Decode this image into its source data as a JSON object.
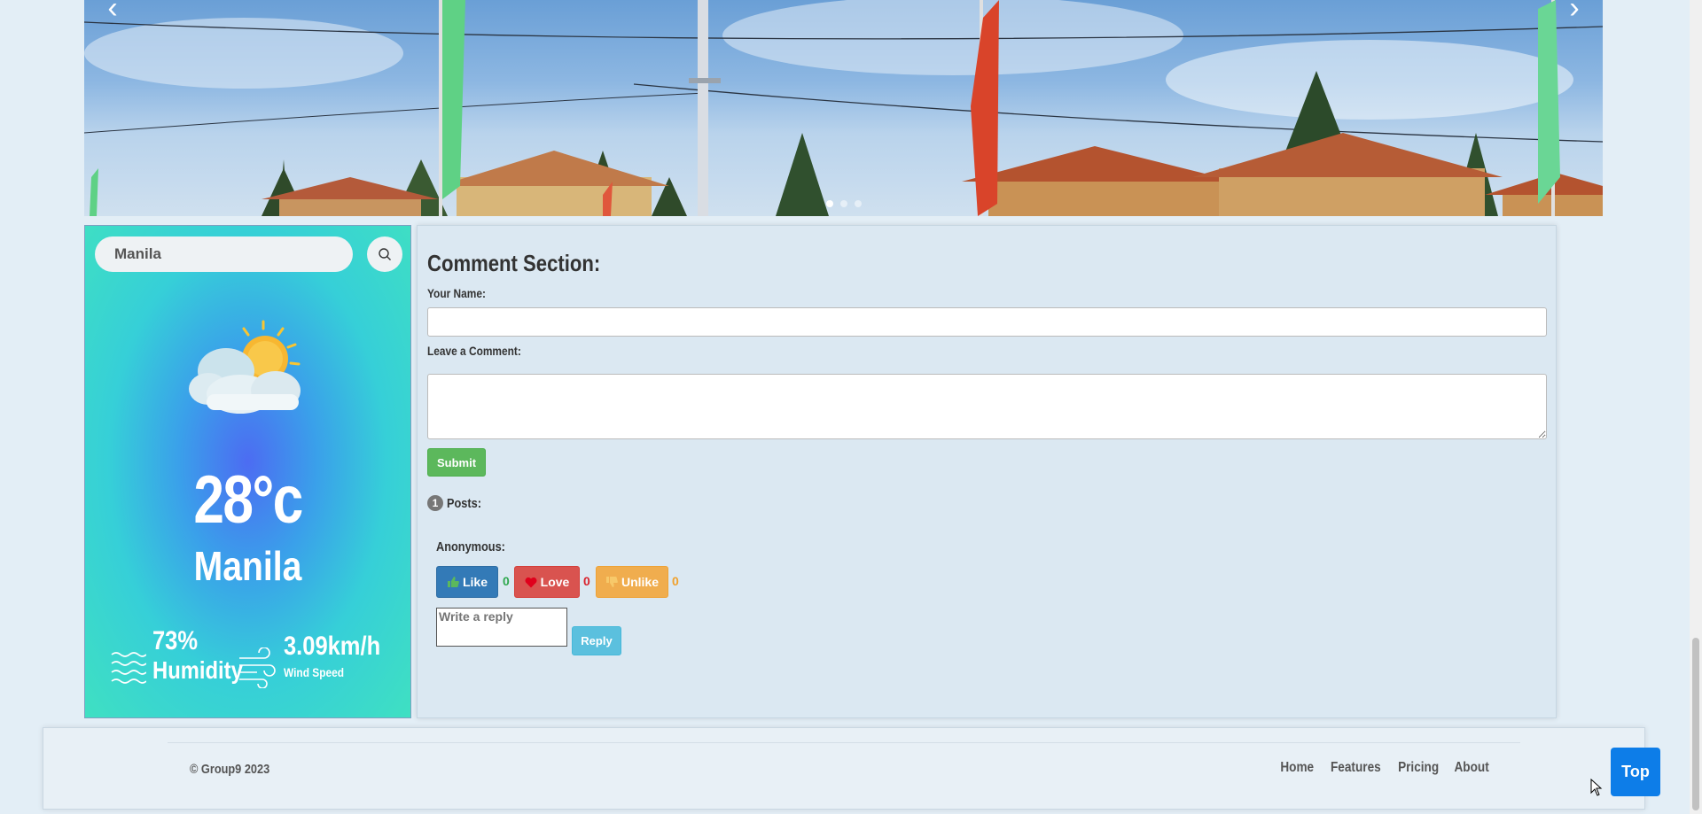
{
  "carousel": {
    "prev_label": "‹",
    "next_label": "›",
    "slide_count": 3,
    "active_slide": 1
  },
  "weather": {
    "search_value": "Manila",
    "search_icon": "search-icon",
    "condition_icon": "partly-cloudy-icon",
    "temperature": "28°c",
    "city": "Manila",
    "humidity_value": "73%",
    "humidity_label": "Humidity",
    "wind_value": "3.09km/h",
    "wind_label": "Wind Speed",
    "gradient_colors": [
      "#4c6cf2",
      "#36cfd8",
      "#3fe0c2"
    ]
  },
  "comments": {
    "title": "Comment Section:",
    "name_label": "Your Name:",
    "name_value": "",
    "comment_label": "Leave a Comment:",
    "comment_value": "",
    "submit_label": "Submit",
    "posts_count": "1",
    "posts_label": "Posts:",
    "post": {
      "author": "Anonymous:",
      "like_label": "Like",
      "like_count": "0",
      "love_label": "Love",
      "love_count": "0",
      "unlike_label": "Unlike",
      "unlike_count": "0",
      "reply_placeholder": "Write a reply",
      "reply_label": "Reply"
    }
  },
  "footer": {
    "copyright": "© Group9 2023",
    "nav": [
      "Home",
      "Features",
      "Pricing",
      "About"
    ],
    "top_label": "Top"
  },
  "colors": {
    "page_bg": "#e3eef6",
    "like": "#337ab7",
    "love": "#d9534f",
    "unlike": "#f0ad4e",
    "submit": "#5cb85c",
    "reply": "#5bc0de",
    "top": "#0d7de8"
  }
}
